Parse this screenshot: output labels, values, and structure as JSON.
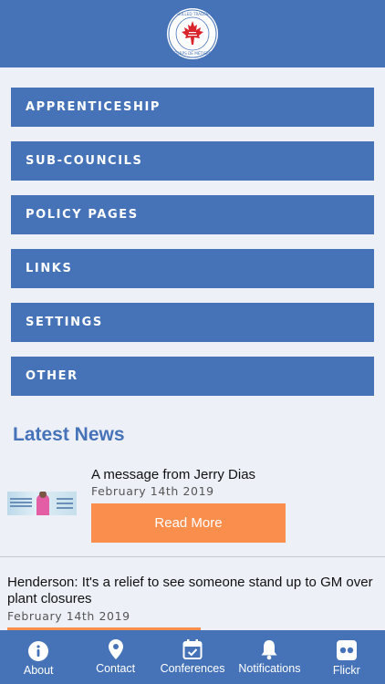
{
  "colors": {
    "brand_blue": "#4673b8",
    "accent_orange": "#fa8f4d",
    "background": "#eef0f8"
  },
  "header": {
    "logo": {
      "icon": "maple-leaf-logo",
      "text_top": "SKILLED TRADES",
      "text_bottom": "CORPS DE MÉTIERS"
    }
  },
  "menu": {
    "items": [
      {
        "label": "APPRENTICESHIP"
      },
      {
        "label": "SUB-COUNCILS"
      },
      {
        "label": "POLICY PAGES"
      },
      {
        "label": "LINKS"
      },
      {
        "label": "SETTINGS"
      },
      {
        "label": "OTHER"
      }
    ]
  },
  "news": {
    "title": "Latest News",
    "items": [
      {
        "title": "A message from Jerry Dias",
        "date": "February 14th 2019",
        "read_more": "Read More",
        "thumbnail": "jerry-dias-photo"
      },
      {
        "title": "Henderson: It's a relief to see someone stand up to GM over plant closures",
        "date": "February 14th 2019"
      }
    ]
  },
  "tabbar": {
    "tabs": [
      {
        "label": "About",
        "icon": "info-icon"
      },
      {
        "label": "Contact",
        "icon": "location-pin-icon"
      },
      {
        "label": "Conferences",
        "icon": "calendar-check-icon"
      },
      {
        "label": "Notifications",
        "icon": "bell-icon"
      },
      {
        "label": "Flickr",
        "icon": "flickr-icon"
      }
    ]
  }
}
